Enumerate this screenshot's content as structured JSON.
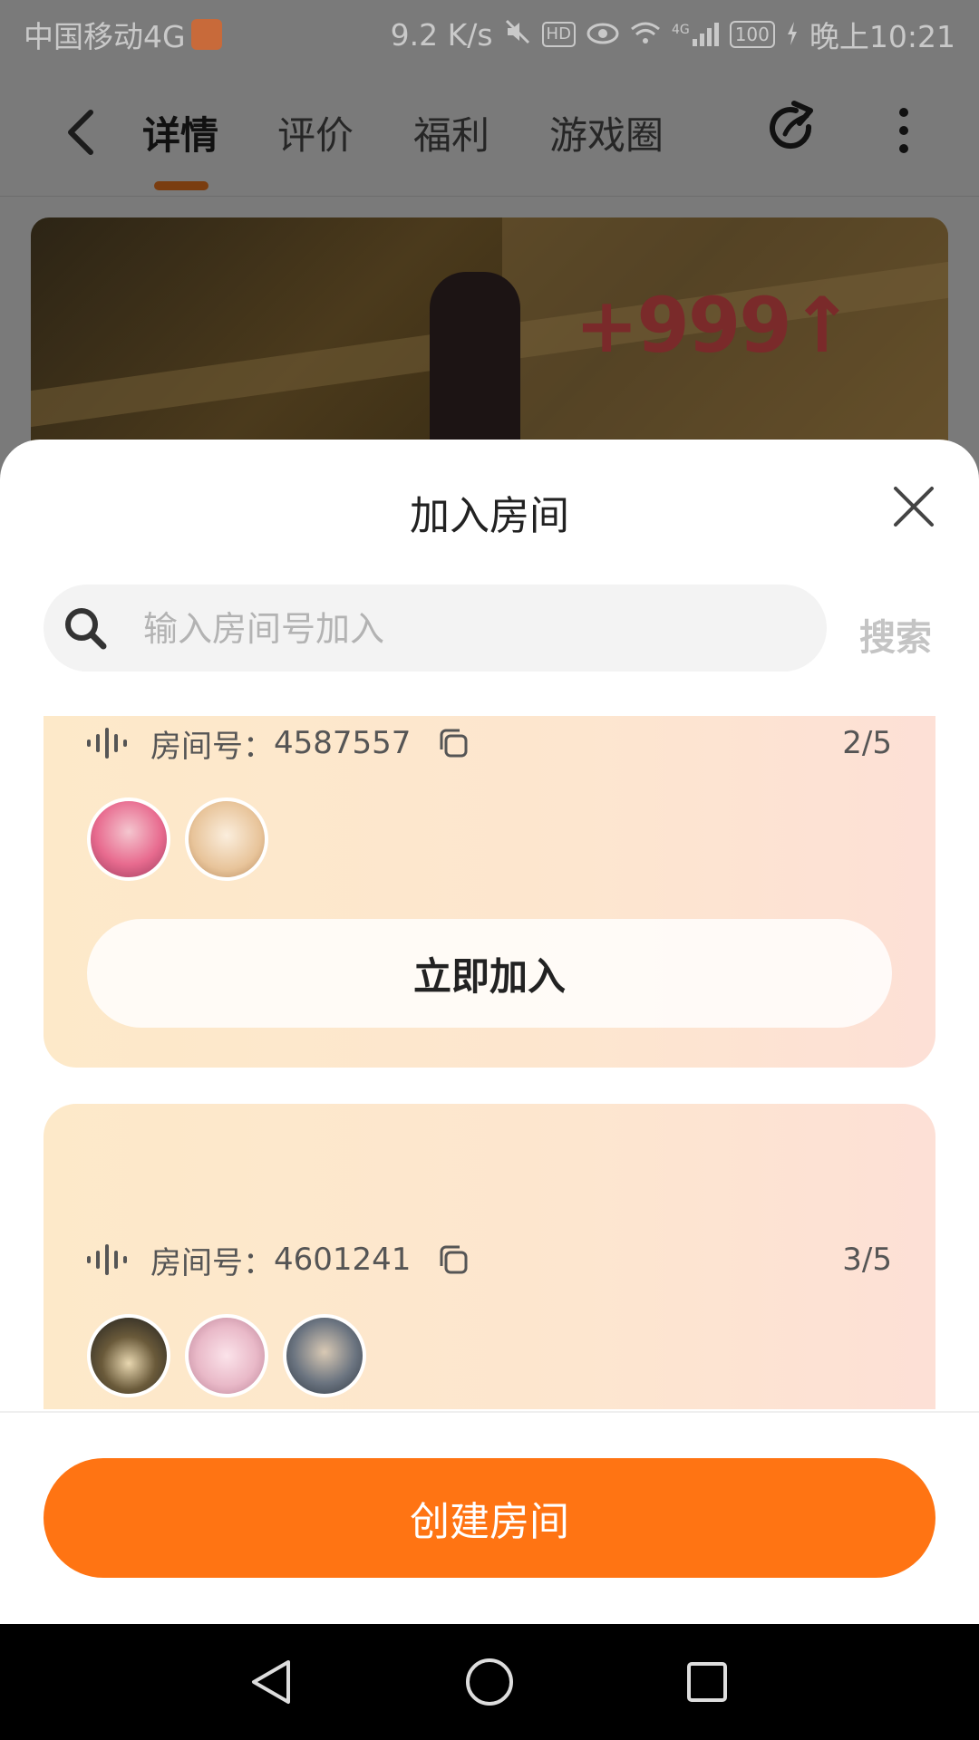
{
  "status_bar": {
    "carrier": "中国移动4G",
    "speed": "9.2 K/s",
    "hd_badge": "HD",
    "network": "4G",
    "battery": "100",
    "time": "晚上10:21"
  },
  "nav": {
    "tabs": [
      {
        "label": "详情"
      },
      {
        "label": "评价"
      },
      {
        "label": "福利"
      },
      {
        "label": "游戏圈"
      }
    ],
    "active_tab": "详情"
  },
  "banner": {
    "score_text": "+999↑"
  },
  "sheet": {
    "title": "加入房间",
    "search": {
      "placeholder": "输入房间号加入",
      "value": "",
      "button_label": "搜索"
    },
    "rooms": [
      {
        "label": "房间号：",
        "number": "4587557",
        "count": "2/5",
        "join_label": "立即加入",
        "avatar_colors": [
          "#e86b8f",
          "#e8c49a"
        ]
      },
      {
        "label": "房间号：",
        "number": "4601241",
        "count": "3/5",
        "avatar_colors": [
          "#3a3a3a",
          "#e9b9c8",
          "#6b7480"
        ]
      }
    ],
    "create_label": "创建房间"
  },
  "colors": {
    "accent": "#ff7413",
    "card_gradient_start": "#fde9c9",
    "card_gradient_end": "#fde0d6"
  }
}
